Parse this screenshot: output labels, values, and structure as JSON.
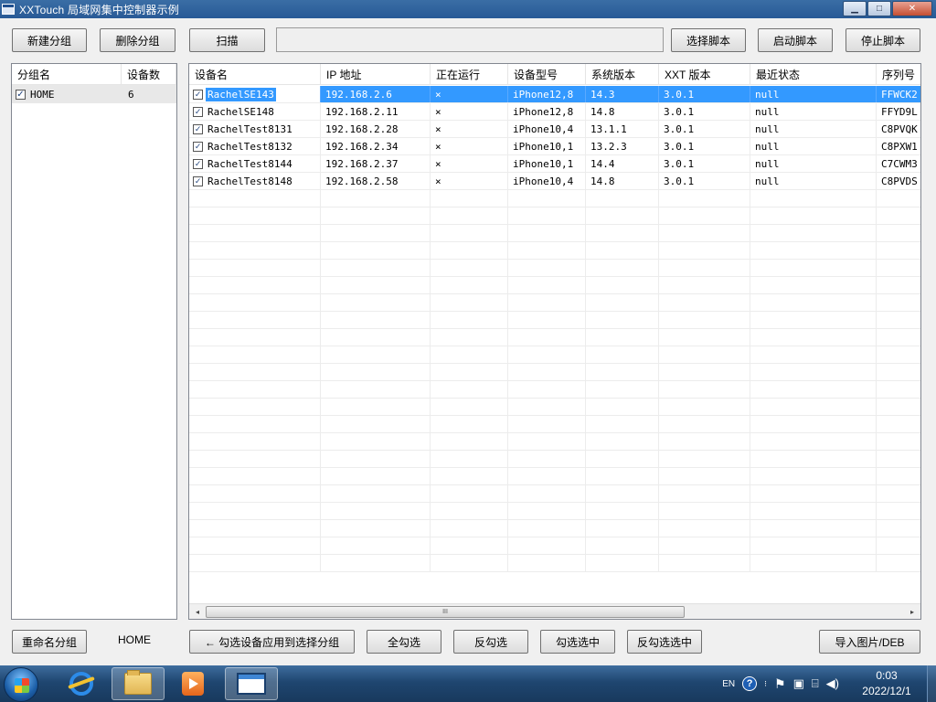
{
  "window": {
    "title": "XXTouch 局域网集中控制器示例",
    "minimize": "▁",
    "maximize": "□",
    "close": "✕"
  },
  "toolbar": {
    "new_group": "新建分组",
    "delete_group": "删除分组",
    "scan": "扫描",
    "script_path": "",
    "select_script": "选择脚本",
    "start_script": "启动脚本",
    "stop_script": "停止脚本"
  },
  "groups": {
    "headers": [
      "分组名",
      "设备数"
    ],
    "rows": [
      {
        "name": "HOME",
        "count": "6",
        "checked": true
      }
    ]
  },
  "devices": {
    "headers": [
      "设备名",
      "IP 地址",
      "正在运行",
      "设备型号",
      "系统版本",
      "XXT 版本",
      "最近状态",
      "序列号"
    ],
    "rows": [
      {
        "name": "RachelSE143",
        "ip": "192.168.2.6",
        "running": "×",
        "model": "iPhone12,8",
        "os": "14.3",
        "xxt": "3.0.1",
        "status": "null",
        "serial": "FFWCK2",
        "checked": true
      },
      {
        "name": "RachelSE148",
        "ip": "192.168.2.11",
        "running": "×",
        "model": "iPhone12,8",
        "os": "14.8",
        "xxt": "3.0.1",
        "status": "null",
        "serial": "FFYD9L",
        "checked": true
      },
      {
        "name": "RachelTest8131",
        "ip": "192.168.2.28",
        "running": "×",
        "model": "iPhone10,4",
        "os": "13.1.1",
        "xxt": "3.0.1",
        "status": "null",
        "serial": "C8PVQK",
        "checked": true
      },
      {
        "name": "RachelTest8132",
        "ip": "192.168.2.34",
        "running": "×",
        "model": "iPhone10,1",
        "os": "13.2.3",
        "xxt": "3.0.1",
        "status": "null",
        "serial": "C8PXW1",
        "checked": true
      },
      {
        "name": "RachelTest8144",
        "ip": "192.168.2.37",
        "running": "×",
        "model": "iPhone10,1",
        "os": "14.4",
        "xxt": "3.0.1",
        "status": "null",
        "serial": "C7CWM3",
        "checked": true
      },
      {
        "name": "RachelTest8148",
        "ip": "192.168.2.58",
        "running": "×",
        "model": "iPhone10,4",
        "os": "14.8",
        "xxt": "3.0.1",
        "status": "null",
        "serial": "C8PVDS",
        "checked": true
      }
    ],
    "scroll_left": "◂",
    "scroll_right": "▸",
    "scroll_grip": "III"
  },
  "bottom": {
    "rename_group": "重命名分组",
    "current_group": "HOME",
    "apply_to_group": "← 勾选设备应用到选择分组",
    "check_all": "全勾选",
    "invert_check": "反勾选",
    "check_selected": "勾选选中",
    "invert_check_selected": "反勾选选中",
    "import": "导入图片/DEB"
  },
  "taskbar": {
    "language": "EN",
    "help": "?",
    "time": "0:03",
    "date": "2022/12/1"
  }
}
